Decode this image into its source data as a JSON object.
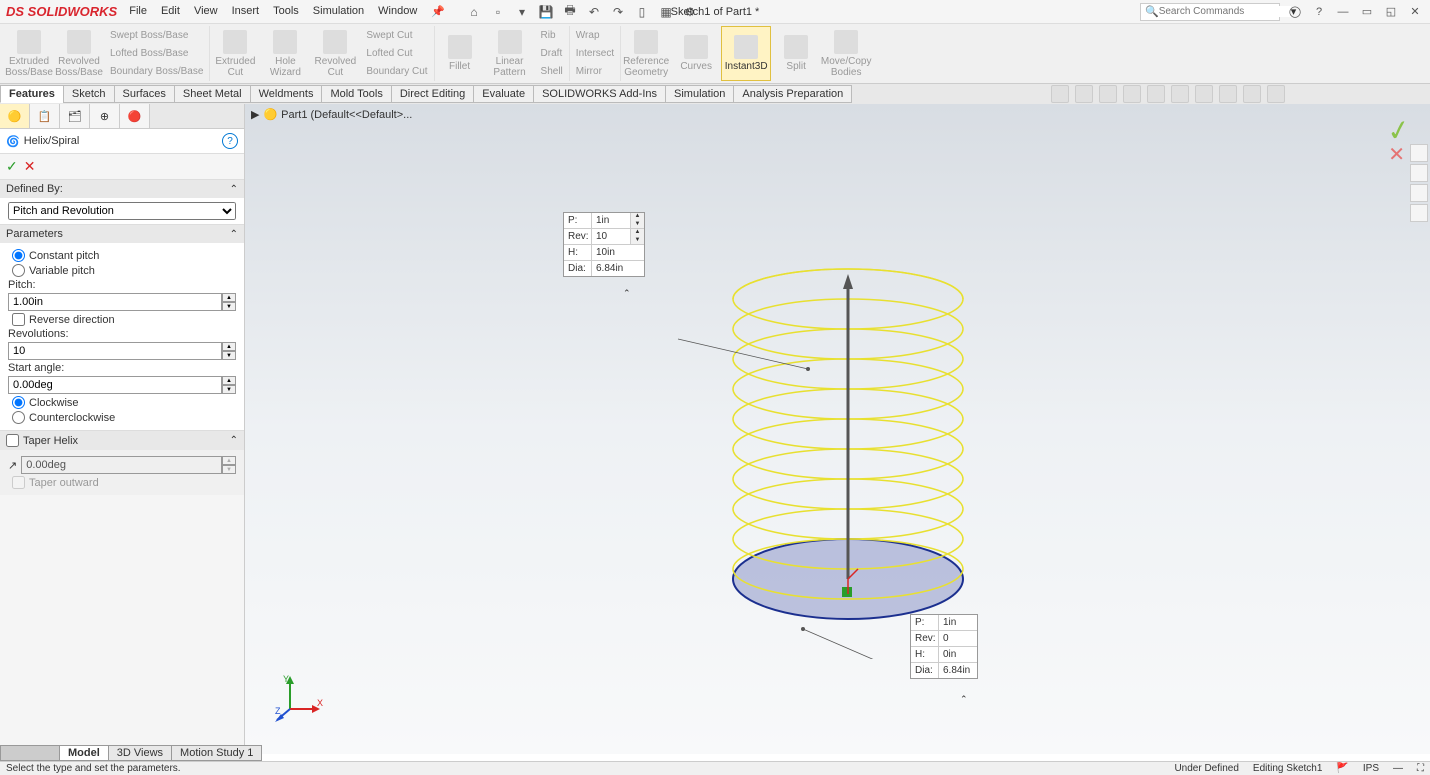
{
  "app": {
    "logo": "SOLIDWORKS",
    "doc_title": "Sketch1 of Part1 *",
    "search_placeholder": "Search Commands"
  },
  "menu": [
    "File",
    "Edit",
    "View",
    "Insert",
    "Tools",
    "Simulation",
    "Window"
  ],
  "ribbon": {
    "groups": [
      {
        "large": [
          {
            "label": "Extruded Boss/Base"
          },
          {
            "label": "Revolved Boss/Base"
          }
        ],
        "small": [
          "Swept Boss/Base",
          "Lofted Boss/Base",
          "Boundary Boss/Base"
        ]
      },
      {
        "large": [
          {
            "label": "Extruded Cut"
          },
          {
            "label": "Hole Wizard"
          },
          {
            "label": "Revolved Cut"
          }
        ],
        "small": [
          "Swept Cut",
          "Lofted Cut",
          "Boundary Cut"
        ]
      },
      {
        "large": [
          {
            "label": "Fillet"
          },
          {
            "label": "Linear Pattern"
          }
        ],
        "small": [
          "Rib",
          "Draft",
          "Shell",
          "Wrap",
          "Intersect",
          "Mirror"
        ]
      },
      {
        "large": [
          {
            "label": "Reference Geometry"
          },
          {
            "label": "Curves"
          }
        ]
      },
      {
        "large": [
          {
            "label": "Instant3D",
            "active": true
          }
        ]
      },
      {
        "large": [
          {
            "label": "Split"
          },
          {
            "label": "Move/Copy Bodies"
          }
        ]
      }
    ]
  },
  "tabs": [
    "Features",
    "Sketch",
    "Surfaces",
    "Sheet Metal",
    "Weldments",
    "Mold Tools",
    "Direct Editing",
    "Evaluate",
    "SOLIDWORKS Add-Ins",
    "Simulation",
    "Analysis Preparation"
  ],
  "active_tab": "Features",
  "breadcrumb": "Part1 (Default<<Default>...",
  "property_manager": {
    "title": "Helix/Spiral",
    "defined_by": {
      "label": "Defined By:",
      "value": "Pitch and Revolution"
    },
    "parameters": {
      "label": "Parameters",
      "pitch_mode": {
        "constant": "Constant pitch",
        "variable": "Variable pitch",
        "selected": "constant"
      },
      "pitch": {
        "label": "Pitch:",
        "value": "1.00in"
      },
      "reverse": {
        "label": "Reverse direction",
        "checked": false
      },
      "revolutions": {
        "label": "Revolutions:",
        "value": "10"
      },
      "start_angle": {
        "label": "Start angle:",
        "value": "0.00deg"
      },
      "direction": {
        "cw": "Clockwise",
        "ccw": "Counterclockwise",
        "selected": "cw"
      }
    },
    "taper": {
      "label": "Taper Helix",
      "checked": false,
      "angle": "0.00deg",
      "outward": "Taper outward"
    }
  },
  "callout_top": {
    "rows": [
      {
        "label": "P:",
        "value": "1in",
        "spin": true
      },
      {
        "label": "Rev:",
        "value": "10",
        "spin": true
      },
      {
        "label": "H:",
        "value": "10in",
        "spin": false
      },
      {
        "label": "Dia:",
        "value": "6.84in",
        "spin": false
      }
    ]
  },
  "callout_bottom": {
    "rows": [
      {
        "label": "P:",
        "value": "1in"
      },
      {
        "label": "Rev:",
        "value": "0"
      },
      {
        "label": "H:",
        "value": "0in"
      },
      {
        "label": "Dia:",
        "value": "6.84in"
      }
    ]
  },
  "bottom_tabs": [
    "Model",
    "3D Views",
    "Motion Study 1"
  ],
  "active_bottom_tab": "Model",
  "status": {
    "hint": "Select the type and set the parameters.",
    "right": [
      "Under Defined",
      "Editing Sketch1",
      "IPS"
    ]
  }
}
